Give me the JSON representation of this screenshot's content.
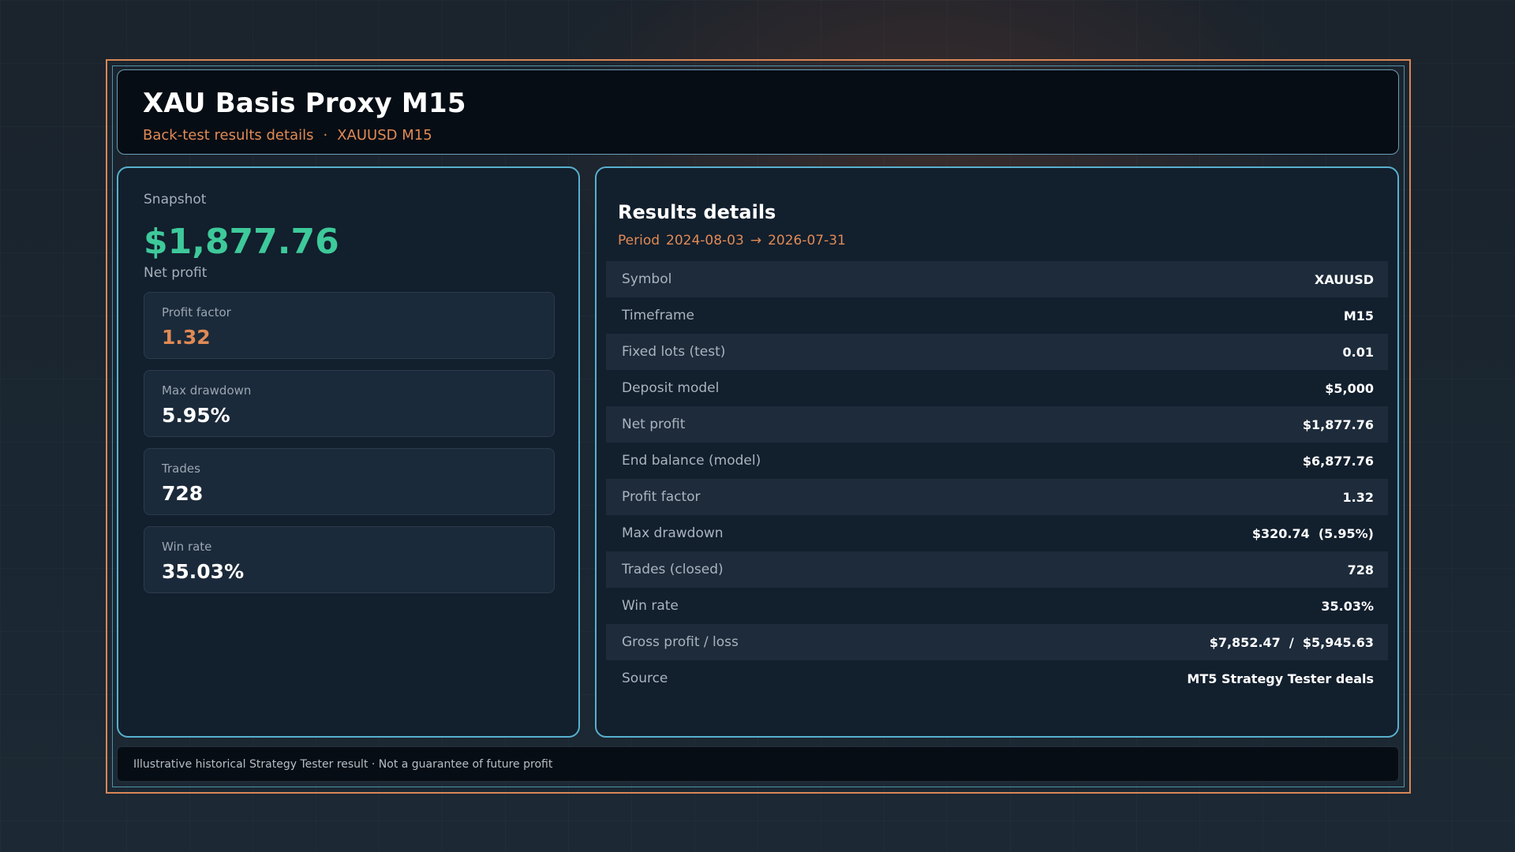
{
  "header": {
    "title": "XAU Basis Proxy M15",
    "subtitle_left": "Back-test results details",
    "separator": "·",
    "subtitle_right": "XAUUSD M15"
  },
  "snapshot": {
    "label": "Snapshot",
    "net_profit_value": "$1,877.76",
    "net_profit_caption": "Net profit",
    "metrics": [
      {
        "label": "Profit factor",
        "value": "1.32"
      },
      {
        "label": "Max drawdown",
        "value": "5.95%"
      },
      {
        "label": "Trades",
        "value": "728"
      },
      {
        "label": "Win rate",
        "value": "35.03%"
      }
    ]
  },
  "results": {
    "title": "Results details",
    "period_label": "Period",
    "period_start": "2024-08-03",
    "period_arrow": "→",
    "period_end": "2026-07-31",
    "rows": [
      {
        "label": "Symbol",
        "value": "XAUUSD"
      },
      {
        "label": "Timeframe",
        "value": "M15"
      },
      {
        "label": "Fixed lots (test)",
        "value": "0.01"
      },
      {
        "label": "Deposit model",
        "value": "$5,000"
      },
      {
        "label": "Net profit",
        "value": "$1,877.76"
      },
      {
        "label": "End balance (model)",
        "value": "$6,877.76"
      },
      {
        "label": "Profit factor",
        "value": "1.32"
      },
      {
        "label": "Max drawdown",
        "value": "$320.74  (5.95%)"
      },
      {
        "label": "Trades (closed)",
        "value": "728"
      },
      {
        "label": "Win rate",
        "value": "35.03%"
      },
      {
        "label": "Gross profit / loss",
        "value": "$7,852.47  /  $5,945.63"
      },
      {
        "label": "Source",
        "value": "MT5 Strategy Tester deals"
      }
    ]
  },
  "footer": {
    "text": "Illustrative historical Strategy Tester result · Not a guarantee of future profit"
  },
  "colors": {
    "accent_orange": "#e08a55",
    "profit_green": "#3ec99a",
    "panel_border": "#58b0cf",
    "frame_border": "#d98656"
  }
}
